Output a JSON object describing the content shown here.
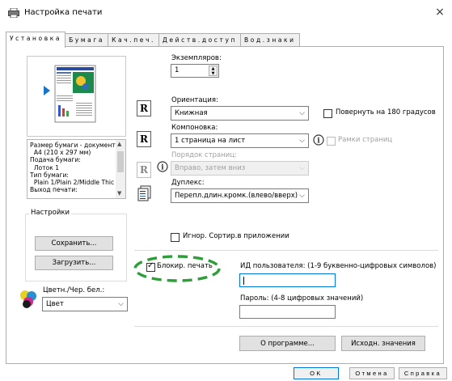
{
  "window": {
    "title": "Настройка печати",
    "close_glyph": "×"
  },
  "tabs": [
    {
      "label": "Установка",
      "active": true
    },
    {
      "label": "Бумага"
    },
    {
      "label": "Кач.печ."
    },
    {
      "label": "Действ.доступ"
    },
    {
      "label": "Вод.знаки"
    }
  ],
  "copies": {
    "label": "Экземпляров:",
    "value": "1"
  },
  "orientation": {
    "label": "Ориентация:",
    "value": "Книжная",
    "rotate_label": "Повернуть на 180 градусов"
  },
  "layout": {
    "label": "Компоновка:",
    "value": "1 страница на лист",
    "page_borders_label": "Рамки страниц"
  },
  "page_order": {
    "label": "Порядок страниц:",
    "value": "Вправо, затем вниз"
  },
  "duplex": {
    "label": "Дуплекс:",
    "value": "Перепл.длин.кромк.(влево/вверх)"
  },
  "info": {
    "lines": [
      "Размер бумаги - документ",
      "  A4 (210 x 297 мм)",
      "Подача бумаги:",
      "  Лоток 1",
      "Тип бумаги:",
      "  Plain 1/Plain 2/Middle Thic",
      "Выход печати:"
    ]
  },
  "settings_group": {
    "title": "Настройки",
    "save_label": "Сохранить...",
    "load_label": "Загрузить..."
  },
  "ignore_sort": {
    "label": "Игнор. Сортир.в приложении"
  },
  "locked_print": {
    "label": "Блокир. печать",
    "checked": true
  },
  "user_id": {
    "label": "ИД пользователя: (1-9 буквенно-цифровых символов)",
    "value": ""
  },
  "password": {
    "label": "Пароль: (4-8 цифровых значений)",
    "value": ""
  },
  "color": {
    "label": "Цветн./Чер. бел.:",
    "value": "Цвет"
  },
  "buttons": {
    "about": "О программе...",
    "defaults": "Исходн. значения"
  },
  "footer": {
    "ok": "OK",
    "cancel": "Отмена",
    "help": "Справка"
  },
  "colors": {
    "focus_border": "#0078d7",
    "highlight_ring": "#2e9d3a"
  }
}
